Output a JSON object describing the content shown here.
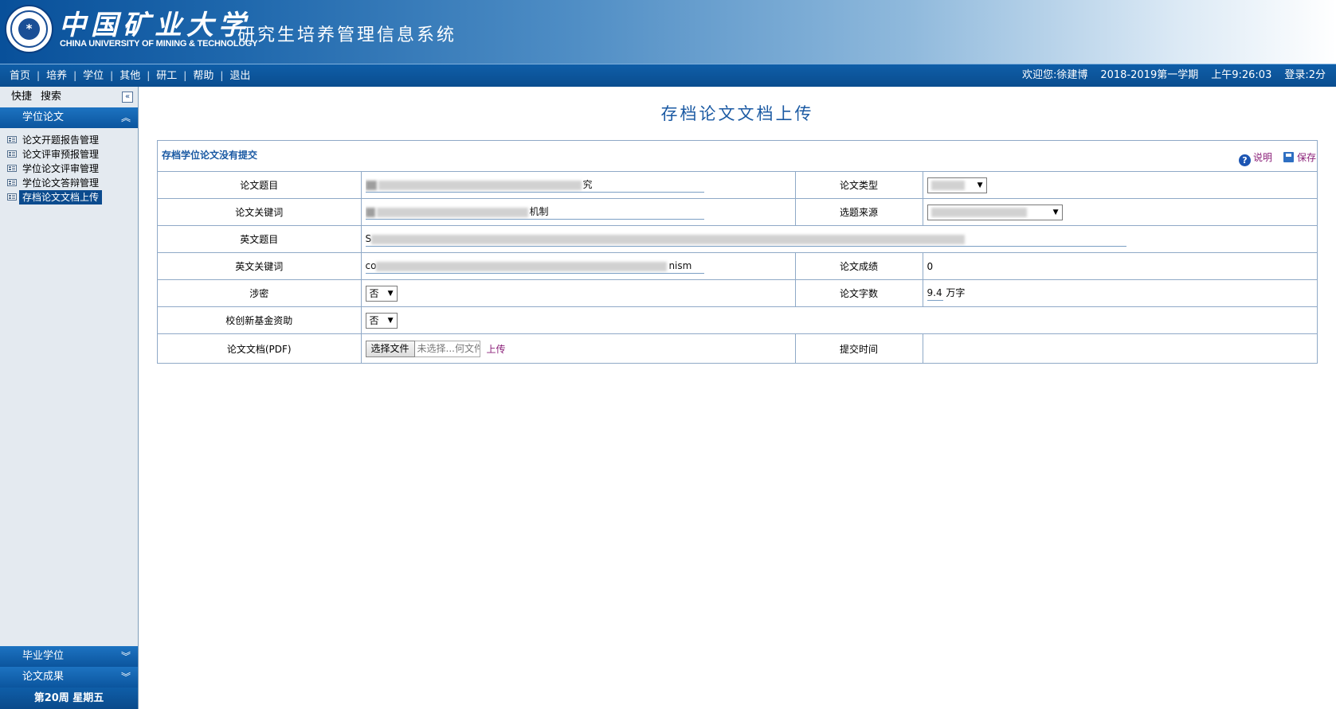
{
  "header": {
    "school_name_cn": "中国矿业大学",
    "school_name_en": "CHINA UNIVERSITY OF MINING & TECHNOLOGY",
    "system_title": "研究生培养管理信息系统",
    "seal_glyph": "*"
  },
  "topnav": {
    "items": [
      "首页",
      "培养",
      "学位",
      "其他",
      "研工",
      "帮助",
      "退出"
    ],
    "separator": "|",
    "welcome": "欢迎您:徐建博",
    "term": "2018-2019第一学期",
    "time": "上午9:26:03",
    "login": "登录:2分"
  },
  "sidebar": {
    "quick_label": "快捷",
    "search_label": "搜索",
    "collapse_glyph": "«",
    "section_open": "学位论文",
    "items": [
      "论文开题报告管理",
      "论文评审预报管理",
      "学位论文评审管理",
      "学位论文答辩管理",
      "存档论文文档上传"
    ],
    "bottom_sections": [
      "毕业学位",
      "论文成果"
    ],
    "week": "第20周 星期五"
  },
  "main": {
    "title": "存档论文文档上传",
    "panel_status": "存档学位论文没有提交",
    "help_label": "说明",
    "save_label": "保存",
    "labels": {
      "title": "论文题目",
      "type": "论文类型",
      "keywords": "论文关键词",
      "source": "选题来源",
      "en_title": "英文题目",
      "en_keywords": "英文关键词",
      "grade": "论文成绩",
      "secret": "涉密",
      "word_count": "论文字数",
      "fund": "校创新基金资助",
      "pdf": "论文文档(PDF)",
      "submit_time": "提交时间"
    },
    "values": {
      "title_tail": "究",
      "keywords_tail": "机制",
      "en_title_head": "S",
      "en_keywords_head": "co",
      "en_keywords_tail": "nism",
      "grade": "0",
      "secret": "否",
      "word_count": "9.4",
      "word_count_unit": "万字",
      "fund": "否",
      "submit_time": ""
    },
    "file": {
      "button": "选择文件",
      "placeholder": "未选择...何文件",
      "upload": "上传"
    }
  }
}
